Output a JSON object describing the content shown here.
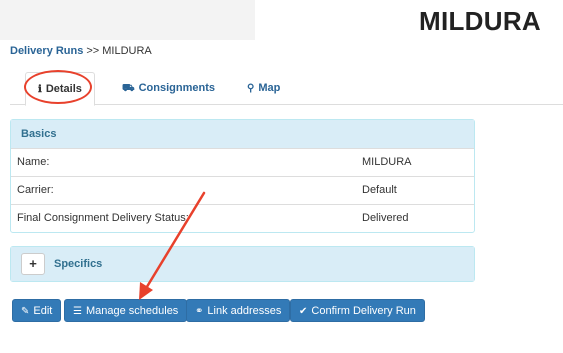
{
  "page": {
    "title": "MILDURA"
  },
  "breadcrumb": {
    "parent": "Delivery Runs",
    "separator": ">>",
    "current": "MILDURA"
  },
  "tabs": [
    {
      "label": "Details",
      "icon": "info-icon"
    },
    {
      "label": "Consignments",
      "icon": "truck-icon"
    },
    {
      "label": "Map",
      "icon": "map-marker-icon"
    }
  ],
  "basics": {
    "heading": "Basics",
    "rows": [
      {
        "label": "Name:",
        "value": "MILDURA"
      },
      {
        "label": "Carrier:",
        "value": "Default"
      },
      {
        "label": "Final Consignment Delivery Status:",
        "value": "Delivered"
      }
    ]
  },
  "specifics": {
    "heading": "Specifics",
    "toggle": "+"
  },
  "actions": {
    "edit": "Edit",
    "manage": "Manage schedules",
    "link": "Link addresses",
    "confirm": "Confirm Delivery Run"
  },
  "colors": {
    "annotation": "#e8412c",
    "primary": "#337ab7",
    "panel_head": "#d9edf7",
    "link": "#2a6496"
  }
}
